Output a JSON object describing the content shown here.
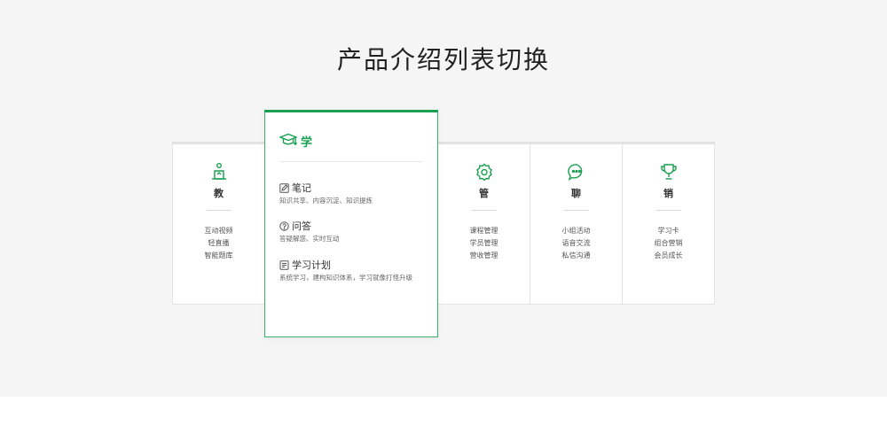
{
  "page": {
    "title": "产品介绍列表切换"
  },
  "colors": {
    "accent": "#1aa051",
    "background": "#f5f5f5"
  },
  "cards": [
    {
      "key": "jiao",
      "name": "教",
      "icon": "lectern-icon",
      "features": [
        "互动视频",
        "轻直播",
        "智能题库"
      ]
    },
    {
      "key": "guan",
      "name": "管",
      "icon": "gear-icon",
      "features": [
        "课程管理",
        "学员管理",
        "营收管理"
      ]
    },
    {
      "key": "liao",
      "name": "聊",
      "icon": "chat-bubble-icon",
      "features": [
        "小组活动",
        "语音交流",
        "私信沟通"
      ]
    },
    {
      "key": "xiao",
      "name": "销",
      "icon": "trophy-icon",
      "features": [
        "学习卡",
        "组合营销",
        "会员成长"
      ]
    }
  ],
  "active": {
    "name": "学",
    "icon": "graduation-cap-icon",
    "sections": [
      {
        "title": "笔记",
        "icon": "note-icon",
        "desc": "知识共享、内容沉淀、知识提炼"
      },
      {
        "title": "问答",
        "icon": "question-icon",
        "desc": "答疑解惑、实时互动"
      },
      {
        "title": "学习计划",
        "icon": "plan-icon",
        "desc": "系统学习，建构知识体系，学习就像打怪升级"
      }
    ]
  }
}
